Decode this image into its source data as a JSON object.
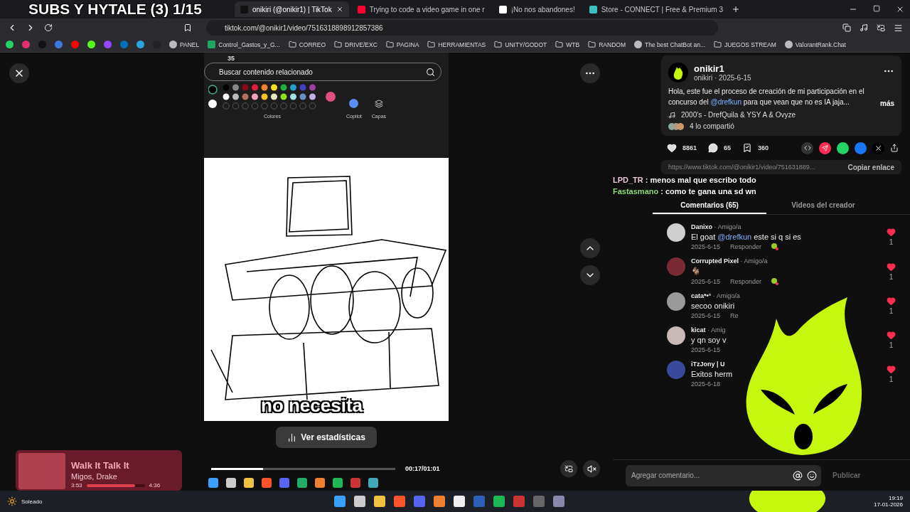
{
  "stream_overlay": {
    "title": "SUBS Y HYTALE (3) 1/15",
    "chat": [
      {
        "user": "LPD_TR",
        "color": "#f2c9dc",
        "message": ": menos mal que escribo todo"
      },
      {
        "user": "Fastasmano",
        "message": ": como te gana una sd wn",
        "color": "#8fe07a"
      }
    ]
  },
  "tabs": [
    {
      "label": "onikiri (@onikir1) | TikTok",
      "selected": true
    },
    {
      "label": "Trying to code a video game in one r",
      "selected": false
    },
    {
      "label": "¡No nos abandones!",
      "selected": false
    },
    {
      "label": "Store - CONNECT | Free & Premium 3",
      "selected": false
    }
  ],
  "address": "tiktok.com/@onikir1/video/7516318898912857386",
  "bookmarks": [
    {
      "label": "PANEL",
      "kind": "site"
    },
    {
      "label": "Control_Gastos_y_G...",
      "kind": "sheet"
    },
    {
      "label": "CORREO",
      "kind": "folder"
    },
    {
      "label": "DRIVE/EXC",
      "kind": "folder"
    },
    {
      "label": "PAGINA",
      "kind": "folder"
    },
    {
      "label": "HERRAMIENTAS",
      "kind": "folder"
    },
    {
      "label": "UNITY/GODOT",
      "kind": "folder"
    },
    {
      "label": "WTB",
      "kind": "folder"
    },
    {
      "label": "RANDOM",
      "kind": "folder"
    },
    {
      "label": "The best ChatBot an...",
      "kind": "site"
    },
    {
      "label": "JUEGOS STREAM",
      "kind": "folder"
    },
    {
      "label": "ValorantRank.Chat",
      "kind": "site"
    }
  ],
  "video": {
    "paint": {
      "search_placeholder": "Buscar contenido relacionado",
      "brush_size": "35",
      "groups": [
        "Colores",
        "Copilot",
        "Capas"
      ]
    },
    "caption": "no necesita",
    "stats_button": "Ver estadísticas",
    "progress": {
      "level": 0.28
    },
    "time": "00:17/01:01",
    "muted": true
  },
  "post": {
    "author": "onikir1",
    "handle_date": "onikiri · 2025-6-15",
    "desc_before": "Hola, este fue el proceso de creación de mi participación en el concurso del ",
    "mention": "@drefkun",
    "desc_after": " para que vean que no es IA jaja...",
    "more": "más",
    "music": "2000's - DrefQuila & YSY A & Ovyze",
    "shared": "4 lo compartió",
    "likes": "8861",
    "comments": "65",
    "saves": "360",
    "link": "https://www.tiktok.com/@onikir1/video/751631889...",
    "copy_link": "Copiar enlace"
  },
  "panel_tabs": [
    {
      "label": "Comentarios (65)",
      "selected": true
    },
    {
      "label": "Videos del creador",
      "selected": false
    }
  ],
  "comments": [
    {
      "author": "Danixo",
      "tag": "· Amigo/a",
      "text_before": "El goat ",
      "mention": "@drefkun",
      "text_after": " este si q si es",
      "date": "2025-6-15",
      "reply": "Responder",
      "creator_liked": true,
      "likes": "1"
    },
    {
      "author": "Corrupted Pixel",
      "tag": "· Amigo/a",
      "text": "🐐",
      "date": "2025-6-15",
      "reply": "Responder",
      "creator_liked": true,
      "likes": "1"
    },
    {
      "author": "cata*•°",
      "tag": "· Amigo/a",
      "text": "secoo onikiri",
      "date": "2025-6-15",
      "reply": "Re",
      "creator_liked": false,
      "likes": "1"
    },
    {
      "author": "kicat",
      "tag": "· Amig",
      "text": "y qn soy v",
      "date": "2025-6-15",
      "creator_liked": false,
      "likes": "1"
    },
    {
      "author": "iTzJony | U",
      "text": "Exitos herm",
      "date": "2025-6-18",
      "creator_liked": false,
      "likes": "1"
    }
  ],
  "comment_input": {
    "placeholder": "Agregar comentario...",
    "submit": "Publicar",
    "disabled": true
  },
  "now_playing": {
    "title": "Walk It Talk It",
    "artist": "Migos, Drake",
    "elapsed": "3:53",
    "level": 0.84,
    "total": "4:36"
  },
  "taskbar": {
    "weather": "Soleado",
    "time": "19:19",
    "date": "17-01-2026"
  }
}
